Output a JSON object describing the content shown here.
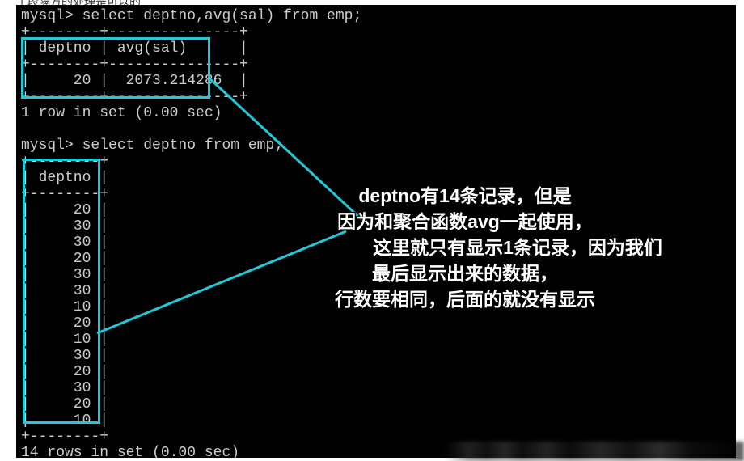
{
  "top_fragment": "了段隔方的处理是可以的",
  "query1": {
    "prompt": "mysql> select deptno,avg(sal) from emp;",
    "sep_top": "+--------+---------------+",
    "header": "| deptno | avg(sal)      |",
    "sep_mid": "+--------+---------------+",
    "row": "|     20 |  2073.214286  |",
    "sep_bot": "+--------+---------------+",
    "status": "1 row in set (0.00 sec)"
  },
  "query2": {
    "prompt": "mysql> select deptno from emp;",
    "sep_top": "+--------+",
    "header": "| deptno |",
    "sep_mid": "+--------+",
    "rows": [
      "|     20 |",
      "|     30 |",
      "|     30 |",
      "|     20 |",
      "|     30 |",
      "|     30 |",
      "|     10 |",
      "|     20 |",
      "|     10 |",
      "|     30 |",
      "|     20 |",
      "|     30 |",
      "|     20 |",
      "|     10 |"
    ],
    "sep_bot": "+--------+",
    "status": "14 rows in set (0.00 sec)"
  },
  "annotation": {
    "l1": "deptno有14条记录，但是",
    "l2": "因为和聚合函数avg一起使用，",
    "l3": "这里就只有显示1条记录，因为我们",
    "l4": "最后显示出来的数据，",
    "l5": "行数要相同，后面的就没有显示"
  }
}
